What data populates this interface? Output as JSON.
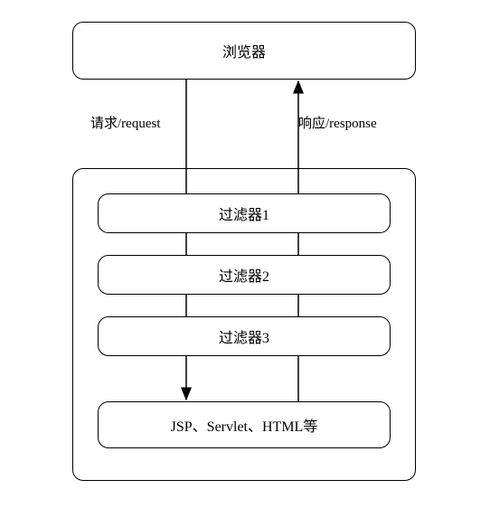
{
  "chart_data": {
    "type": "diagram",
    "nodes": [
      {
        "id": "browser",
        "label": "浏览器"
      },
      {
        "id": "filter1",
        "label": "过滤器1"
      },
      {
        "id": "filter2",
        "label": "过滤器2"
      },
      {
        "id": "filter3",
        "label": "过滤器3"
      },
      {
        "id": "target",
        "label": "JSP、Servlet、HTML等"
      }
    ],
    "edges": [
      {
        "from": "browser",
        "to": "target",
        "label": "请求/request"
      },
      {
        "from": "target",
        "to": "browser",
        "label": "响应/response"
      }
    ],
    "container_label": ""
  },
  "browser": {
    "label": "浏览器"
  },
  "filter1": {
    "label": "过滤器1"
  },
  "filter2": {
    "label": "过滤器2"
  },
  "filter3": {
    "label": "过滤器3"
  },
  "target": {
    "label": "JSP、Servlet、HTML等"
  },
  "arrow_left_label": "请求/request",
  "arrow_right_label": "响应/response"
}
